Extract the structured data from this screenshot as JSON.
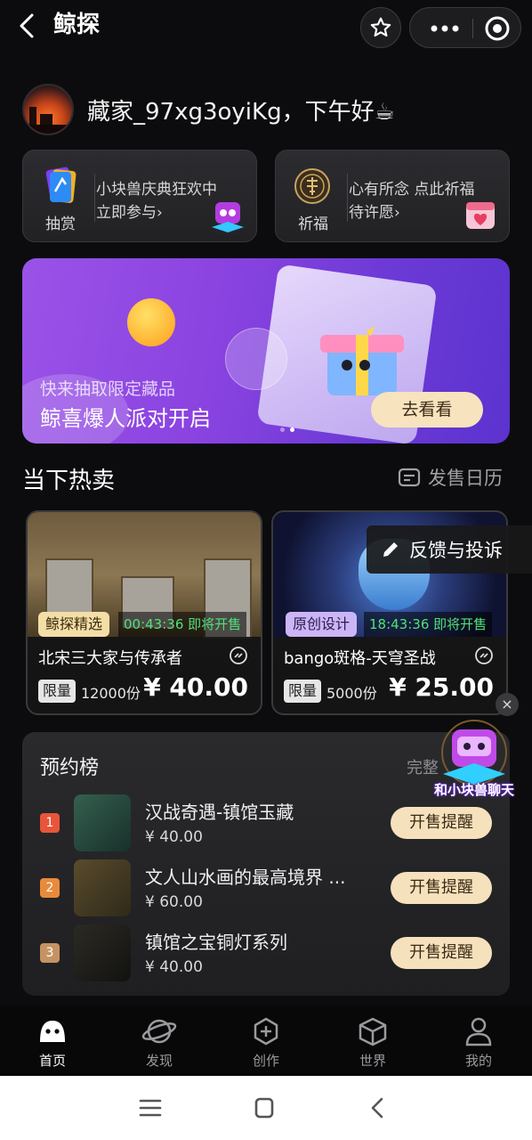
{
  "header": {
    "title": "鲸探"
  },
  "greeting": {
    "text": "藏家_97xg3oyiKg，下午好☕"
  },
  "cards": [
    {
      "icon_label": "抽赏",
      "line1": "小块兽庆典狂欢中",
      "line2": "立即参与›"
    },
    {
      "icon_label": "祈福",
      "line1": "心有所念 点此祈福",
      "line2": "待许愿›"
    }
  ],
  "banner": {
    "subtitle": "快来抽取限定藏品",
    "headline": "鲸喜爆人派对开启",
    "cta": "去看看"
  },
  "hot_section": {
    "title": "当下热卖",
    "calendar_label": "发售日历"
  },
  "products": [
    {
      "tag": "鲸探精选",
      "timer": "00:43:36 即将开售",
      "name": "北宋三大家与传承者",
      "limit_label": "限量",
      "count": "12000份",
      "price": "¥ 40.00"
    },
    {
      "tag": "原创设计",
      "timer": "18:43:36 即将开售",
      "name": "bango斑格-天穹圣战",
      "limit_label": "限量",
      "count": "5000份",
      "price": "¥ 25.00"
    }
  ],
  "feedback": {
    "label": "反馈与投诉"
  },
  "ranking": {
    "title": "预约榜",
    "view_all": "完整",
    "items": [
      {
        "rank": "1",
        "name": "汉战奇遇-镇馆玉藏",
        "price": "¥ 40.00",
        "button": "开售提醒",
        "color": "#e8553a"
      },
      {
        "rank": "2",
        "name": "文人山水画的最高境界 ...",
        "price": "¥ 60.00",
        "button": "开售提醒",
        "color": "#e98a3a"
      },
      {
        "rank": "3",
        "name": "镇馆之宝铜灯系列",
        "price": "¥ 40.00",
        "button": "开售提醒",
        "color": "#c59363"
      }
    ]
  },
  "mascot": {
    "label": "和小块兽聊天",
    "close": "×"
  },
  "tabs": [
    {
      "label": "首页",
      "icon": "home-icon",
      "active": true
    },
    {
      "label": "发现",
      "icon": "planet-icon"
    },
    {
      "label": "创作",
      "icon": "plus-circle-icon"
    },
    {
      "label": "世界",
      "icon": "cube-icon"
    },
    {
      "label": "我的",
      "icon": "person-icon"
    }
  ],
  "colors": {
    "background": "#0c0c0e",
    "accent_gold": "#f6e1bd",
    "timer_green": "#52e07a",
    "banner_purple": "#8a43e0"
  }
}
